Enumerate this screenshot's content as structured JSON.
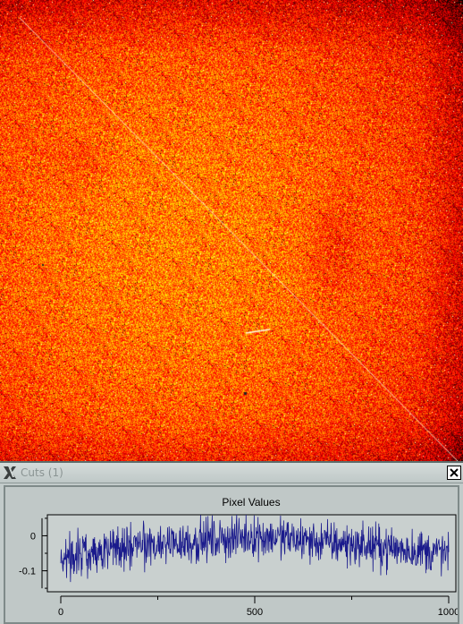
{
  "image_view": {
    "colormap": "heat",
    "features": [
      "diagonal-streak",
      "central-bright-region",
      "dark-corner-vignette"
    ]
  },
  "cuts_window": {
    "title": "Cuts (1)",
    "close_icon": "close-icon",
    "logo_icon": "x-logo-icon"
  },
  "chart_data": {
    "type": "line",
    "title": "Pixel Values",
    "xlabel": "",
    "ylabel": "",
    "xlim": [
      0,
      1000
    ],
    "ylim": [
      -0.16,
      0.06
    ],
    "x_ticks": [
      0,
      500,
      1000
    ],
    "x_tick_labels": [
      "0",
      "500",
      "1000"
    ],
    "y_ticks": [
      0,
      -0.1
    ],
    "y_tick_labels": [
      "0",
      "-0.1"
    ],
    "grid": false,
    "series": [
      {
        "color": "#1a1a8c",
        "n_points": 1000,
        "trend_x": [
          0,
          100,
          200,
          300,
          400,
          500,
          600,
          700,
          800,
          900,
          1000
        ],
        "trend_y": [
          -0.06,
          -0.04,
          -0.03,
          -0.02,
          -0.01,
          0.0,
          -0.01,
          -0.02,
          -0.03,
          -0.04,
          -0.05
        ],
        "noise_amplitude": 0.03
      }
    ]
  }
}
